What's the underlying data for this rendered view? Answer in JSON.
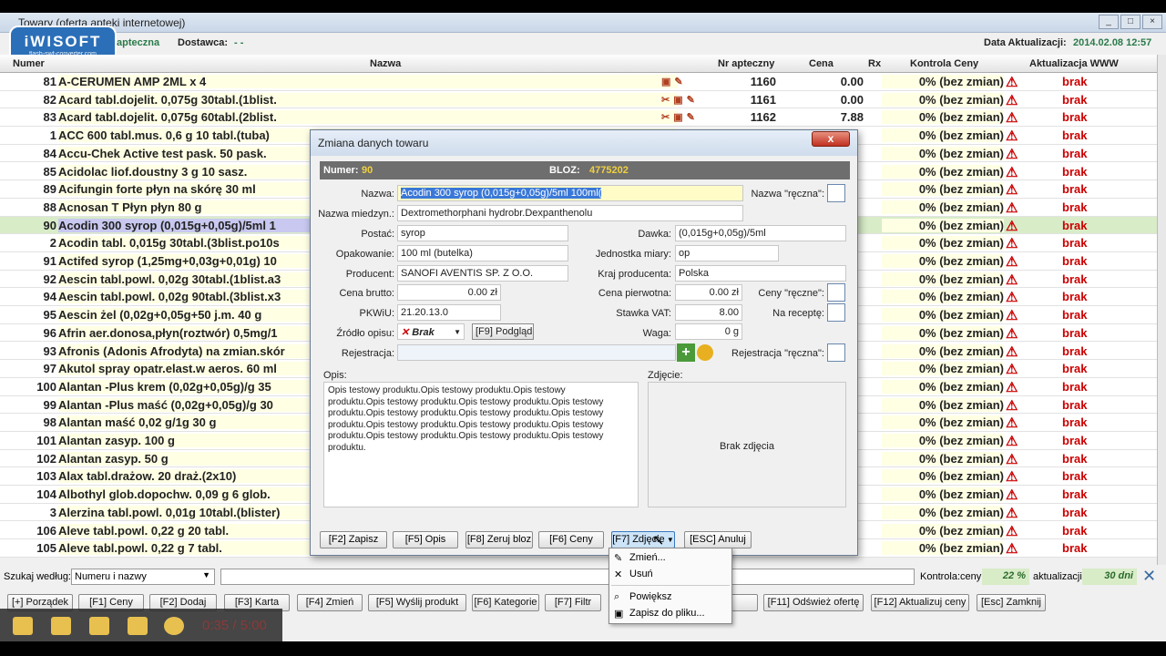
{
  "window": {
    "title": "Towary (oferta apteki internetowej)"
  },
  "logo": {
    "brand": "iWISOFT",
    "sub": "flash-swf-converter.com"
  },
  "infobar": {
    "pharmacy": "apteczna",
    "supplier_label": "Dostawca:",
    "supplier_value": "- -",
    "update_label": "Data Aktualizacji:",
    "update_value": "2014.02.08 12:57"
  },
  "columns": {
    "numer": "Numer",
    "nazwa": "Nazwa",
    "nr": "Nr apteczny",
    "cena": "Cena",
    "rx": "Rx",
    "kontrola": "Kontrola Ceny",
    "aktualizacja": "Aktualizacja  WWW"
  },
  "rows": [
    {
      "num": "81",
      "name": "A-CERUMEN AMP 2ML x 4",
      "nr": "1160",
      "cena": "0.00",
      "kc": "0% (bez zmian)",
      "akt": "brak"
    },
    {
      "num": "82",
      "name": "Acard tabl.dojelit. 0,075g 30tabl.(1blist.",
      "nr": "1161",
      "cena": "0.00",
      "kc": "0% (bez zmian)",
      "akt": "brak"
    },
    {
      "num": "83",
      "name": "Acard tabl.dojelit. 0,075g 60tabl.(2blist.",
      "nr": "1162",
      "cena": "7.88",
      "kc": "0% (bez zmian)",
      "akt": "brak"
    },
    {
      "num": "1",
      "name": "ACC 600 tabl.mus. 0,6 g 10 tabl.(tuba)",
      "nr": "",
      "cena": "",
      "kc": "0% (bez zmian)",
      "akt": "brak"
    },
    {
      "num": "84",
      "name": "Accu-Chek Active test pask. 50 pask.",
      "nr": "",
      "cena": "",
      "kc": "0% (bez zmian)",
      "akt": "brak"
    },
    {
      "num": "85",
      "name": "Acidolac liof.doustny 3 g 10 sasz.",
      "nr": "",
      "cena": "",
      "kc": "0% (bez zmian)",
      "akt": "brak"
    },
    {
      "num": "89",
      "name": "Acifungin forte płyn na skórę 30 ml",
      "nr": "",
      "cena": "",
      "kc": "0% (bez zmian)",
      "akt": "brak"
    },
    {
      "num": "88",
      "name": "Acnosan T Płyn płyn 80 g",
      "nr": "",
      "cena": "",
      "kc": "0% (bez zmian)",
      "akt": "brak"
    },
    {
      "num": "90",
      "name": "Acodin 300 syrop (0,015g+0,05g)/5ml 1",
      "nr": "",
      "cena": "",
      "kc": "0% (bez zmian)",
      "akt": "brak"
    },
    {
      "num": "2",
      "name": "Acodin tabl. 0,015g 30tabl.(3blist.po10s",
      "nr": "",
      "cena": "",
      "kc": "0% (bez zmian)",
      "akt": "brak"
    },
    {
      "num": "91",
      "name": "Actifed syrop (1,25mg+0,03g+0,01g) 10",
      "nr": "",
      "cena": "",
      "kc": "0% (bez zmian)",
      "akt": "brak"
    },
    {
      "num": "92",
      "name": "Aescin tabl.powl. 0,02g 30tabl.(1blist.a3",
      "nr": "",
      "cena": "",
      "kc": "0% (bez zmian)",
      "akt": "brak"
    },
    {
      "num": "94",
      "name": "Aescin tabl.powl. 0,02g 90tabl.(3blist.x3",
      "nr": "",
      "cena": "",
      "kc": "0% (bez zmian)",
      "akt": "brak"
    },
    {
      "num": "95",
      "name": "Aescin żel (0,02g+0,05g+50 j.m. 40 g",
      "nr": "",
      "cena": "",
      "kc": "0% (bez zmian)",
      "akt": "brak"
    },
    {
      "num": "96",
      "name": "Afrin aer.donosa,płyn(roztwór) 0,5mg/1",
      "nr": "",
      "cena": "",
      "kc": "0% (bez zmian)",
      "akt": "brak"
    },
    {
      "num": "93",
      "name": "Afronis (Adonis Afrodyta) na zmian.skór",
      "nr": "",
      "cena": "",
      "kc": "0% (bez zmian)",
      "akt": "brak"
    },
    {
      "num": "97",
      "name": "Akutol spray opatr.elast.w aeros. 60 ml",
      "nr": "",
      "cena": "",
      "kc": "0% (bez zmian)",
      "akt": "brak"
    },
    {
      "num": "100",
      "name": "Alantan -Plus krem (0,02g+0,05g)/g 35",
      "nr": "",
      "cena": "",
      "kc": "0% (bez zmian)",
      "akt": "brak"
    },
    {
      "num": "99",
      "name": "Alantan -Plus maść (0,02g+0,05g)/g 30",
      "nr": "",
      "cena": "",
      "kc": "0% (bez zmian)",
      "akt": "brak"
    },
    {
      "num": "98",
      "name": "Alantan maść 0,02 g/1g 30 g",
      "nr": "",
      "cena": "",
      "kc": "0% (bez zmian)",
      "akt": "brak"
    },
    {
      "num": "101",
      "name": "Alantan zasyp. 100 g",
      "nr": "",
      "cena": "",
      "kc": "0% (bez zmian)",
      "akt": "brak"
    },
    {
      "num": "102",
      "name": "Alantan zasyp. 50 g",
      "nr": "",
      "cena": "",
      "kc": "0% (bez zmian)",
      "akt": "brak"
    },
    {
      "num": "103",
      "name": "Alax tabl.drażow. 20 draż.(2x10)",
      "nr": "",
      "cena": "",
      "kc": "0% (bez zmian)",
      "akt": "brak"
    },
    {
      "num": "104",
      "name": "Albothyl glob.dopochw. 0,09 g 6 glob.",
      "nr": "",
      "cena": "",
      "kc": "0% (bez zmian)",
      "akt": "brak"
    },
    {
      "num": "3",
      "name": "Alerzina tabl.powl. 0,01g 10tabl.(blister)",
      "nr": "",
      "cena": "",
      "kc": "0% (bez zmian)",
      "akt": "brak"
    },
    {
      "num": "106",
      "name": "Aleve tabl.powl. 0,22 g 20 tabl.",
      "nr": "",
      "cena": "",
      "kc": "0% (bez zmian)",
      "akt": "brak"
    },
    {
      "num": "105",
      "name": "Aleve tabl.powl. 0,22 g 7 tabl.",
      "nr": "",
      "cena": "",
      "kc": "0% (bez zmian)",
      "akt": "brak"
    }
  ],
  "selected_row": 8,
  "search": {
    "label": "Szukaj według:",
    "value": "Numeru i nazwy",
    "kontrola_label": "Kontrola:",
    "ceny_label": "ceny",
    "ceny_value": "22 %",
    "akt_label": "aktualizacji",
    "akt_value": "30 dni"
  },
  "fbar": [
    "[+] Porządek",
    "[F1] Ceny",
    "[F2] Dodaj",
    "[F3] Karta",
    "[F4] Zmień",
    "[F5] Wyślij produkt",
    "[F6] Kategorie",
    "[F7] Filtr",
    "[F8] Aktualizuj",
    "[F11] Odśwież ofertę",
    "[F12] Aktualizuj ceny",
    "[Esc] Zamknij"
  ],
  "player": {
    "time": "0:35 / 5:00"
  },
  "dialog": {
    "title": "Zmiana danych towaru",
    "close": "x",
    "numer_label": "Numer:",
    "numer_value": "90",
    "bloz_label": "BLOZ:",
    "bloz_value": "4775202",
    "nazwa_label": "Nazwa:",
    "nazwa_value": "Acodin 300 syrop (0,015g+0,05g)/5ml 100ml(",
    "nazwa_reczna_label": "Nazwa \"ręczna\":",
    "miedzyn_label": "Nazwa miedzyn.:",
    "miedzyn_value": "Dextromethorphani hydrobr.Dexpanthenolu",
    "postac_label": "Postać:",
    "postac_value": "syrop",
    "dawka_label": "Dawka:",
    "dawka_value": "(0,015g+0,05g)/5ml",
    "opak_label": "Opakowanie:",
    "opak_value": "100 ml (butelka)",
    "jedn_label": "Jednostka miary:",
    "jedn_value": "op",
    "prod_label": "Producent:",
    "prod_value": "SANOFI AVENTIS SP. Z O.O.",
    "kraj_label": "Kraj producenta:",
    "kraj_value": "Polska",
    "brutto_label": "Cena brutto:",
    "brutto_value": "0.00 zł",
    "pierw_label": "Cena pierwotna:",
    "pierw_value": "0.00 zł",
    "ceny_reczne_label": "Ceny \"ręczne\":",
    "pkwiu_label": "PKWiU:",
    "pkwiu_value": "21.20.13.0",
    "vat_label": "Stawka VAT:",
    "vat_value": "8.00",
    "recepta_label": "Na receptę:",
    "zrodlo_label": "Źródło opisu:",
    "zrodlo_value": "Brak",
    "podglad": "[F9] Podgląd",
    "waga_label": "Waga:",
    "waga_value": "0 g",
    "rejestr_label": "Rejestracja:",
    "rejestr_reczna_label": "Rejestracja \"ręczna\":",
    "opis_label": "Opis:",
    "opis_text": "Opis testowy produktu.Opis testowy produktu.Opis testowy produktu.Opis testowy produktu.Opis testowy produktu.Opis testowy produktu.Opis testowy produktu.Opis testowy produktu.Opis testowy produktu.Opis testowy produktu.Opis testowy produktu.Opis testowy produktu.Opis testowy produktu.Opis testowy produktu.Opis testowy produktu.",
    "zdjecie_label": "Zdjęcie:",
    "brak_zdjecia": "Brak zdjęcia",
    "btn_zapisz": "[F2] Zapisz",
    "btn_opis": "[F5] Opis",
    "btn_zeruj": "[F8] Zeruj bloz",
    "btn_ceny": "[F6] Ceny",
    "btn_zdjecie": "[F7] Zdjęcie",
    "btn_anuluj": "[ESC] Anuluj"
  },
  "menu": {
    "zmien": "Zmień...",
    "usun": "Usuń",
    "powieksz": "Powiększ",
    "zapisz": "Zapisz do pliku..."
  }
}
